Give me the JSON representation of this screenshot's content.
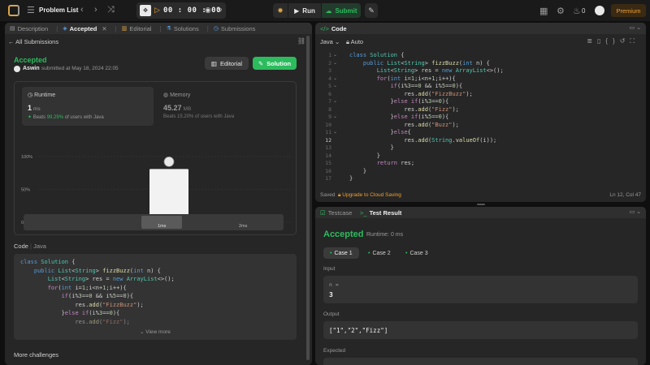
{
  "topbar": {
    "problem_list_label": "Problem List",
    "timer": "00 : 00 : 00",
    "run_label": "Run",
    "submit_label": "Submit",
    "streak_count": "0",
    "premium_label": "Premium"
  },
  "left_tabs": [
    {
      "label": "Description",
      "icon": "description-icon"
    },
    {
      "label": "Accepted",
      "icon": "accepted-icon"
    },
    {
      "label": "Editorial",
      "icon": "editorial-icon"
    },
    {
      "label": "Solutions",
      "icon": "solutions-icon"
    },
    {
      "label": "Submissions",
      "icon": "submissions-icon"
    }
  ],
  "submission": {
    "back_label": "All Submissions",
    "status": "Accepted",
    "user": "Aswin",
    "submitted_text": "submitted at May 18, 2024 22:05",
    "editorial_btn": "Editorial",
    "solution_btn": "Solution"
  },
  "runtime": {
    "label": "Runtime",
    "value": "1",
    "unit": "ms",
    "beats_prefix": "Beats",
    "beats_pct": "99.29%",
    "beats_suffix": "of users with Java"
  },
  "memory": {
    "label": "Memory",
    "value": "45.27",
    "unit": "MB",
    "beats_text": "Beats 15.20% of users with Java"
  },
  "chart_data": {
    "type": "bar",
    "categories": [
      "",
      "1ms",
      "2ms"
    ],
    "values": [
      2,
      81,
      10
    ],
    "highlight_index": 1,
    "y_ticks": [
      "100%",
      "50%",
      "0%"
    ],
    "ylim": [
      0,
      100
    ],
    "grid": true,
    "mini_labels": [
      "1ms",
      "2ms"
    ]
  },
  "code_section": {
    "header": "Code",
    "lang": "Java",
    "lines": [
      "class Solution {",
      "    public List<String> fizzBuzz(int n) {",
      "        List<String> res = new ArrayList<>();",
      "        for(int i=1;i<n+1;i++){",
      "            if(i%3==0 && i%5==0){",
      "                res.add(\"FizzBuzz\");",
      "            }else if(i%3==0){",
      "                res.add(\"Fizz\");"
    ],
    "view_more": "View more"
  },
  "more_challenges": "More challenges",
  "editor": {
    "title": "Code",
    "language": "Java",
    "mode": "Auto",
    "line_numbers": [
      "1",
      "2",
      "3",
      "4",
      "5",
      "6",
      "7",
      "8",
      "9",
      "10",
      "11",
      "12",
      "13",
      "14",
      "15",
      "16",
      "17"
    ],
    "saved_label": "Saved",
    "upgrade_label": "Upgrade to Cloud Saving",
    "cursor_pos": "Ln 12, Col 47"
  },
  "result": {
    "tab_testcase": "Testcase",
    "tab_result": "Test Result",
    "status": "Accepted",
    "runtime_text": "Runtime: 0 ms",
    "cases": [
      "Case 1",
      "Case 2",
      "Case 3"
    ],
    "input_label": "Input",
    "input_name": "n =",
    "input_value": "3",
    "output_label": "Output",
    "output_value": "[\"1\",\"2\",\"Fizz\"]",
    "expected_label": "Expected"
  },
  "colors": {
    "accent_green": "#2cbb5d",
    "accent_orange": "#f0a030",
    "panel_bg": "#262626"
  }
}
